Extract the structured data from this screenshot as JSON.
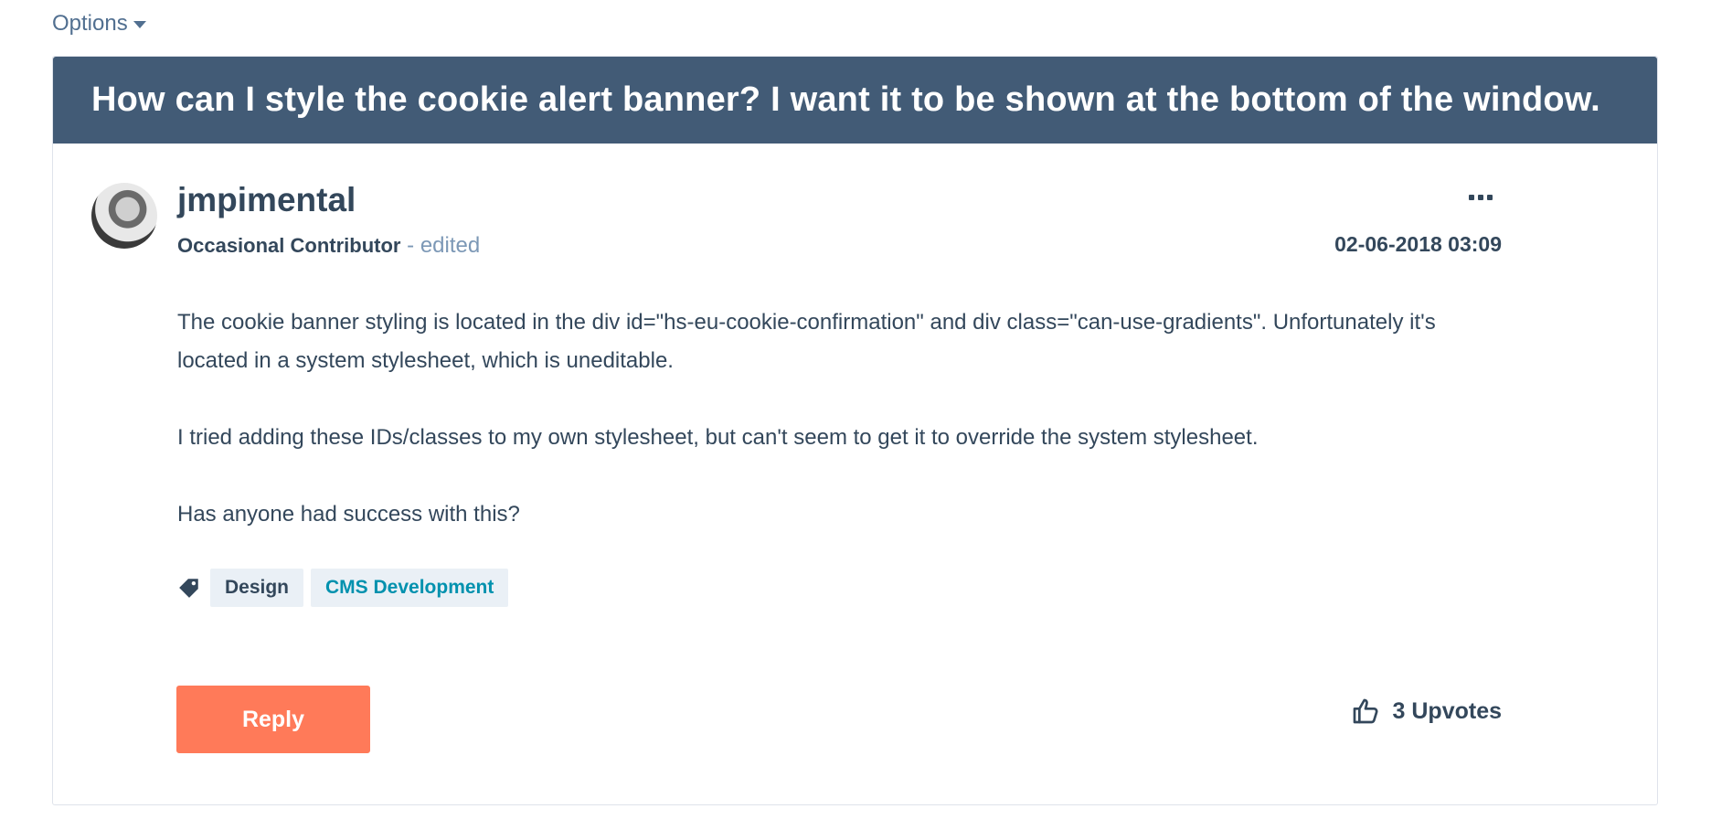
{
  "options": {
    "label": "Options"
  },
  "post": {
    "title": "How can I style the cookie alert banner? I want it to be shown at the bottom of the window.",
    "author": "jmpimental",
    "rank": "Occasional Contributor",
    "edited": " - edited",
    "date": "02-06-2018 03:09",
    "paragraphs": [
      "The cookie banner styling is located in the div id=\"hs-eu-cookie-confirmation\" and div class=\"can-use-gradients\". Unfortunately it's located in a system stylesheet, which is uneditable.",
      "I tried adding these IDs/classes to my own stylesheet, but can't seem to get it to override the system stylesheet.",
      "Has anyone had success with this?"
    ],
    "tags": [
      "Design",
      "CMS Development"
    ],
    "reply_label": "Reply",
    "upvotes_label": "3 Upvotes"
  },
  "colors": {
    "header_bg": "#425b76",
    "reply_bg": "#ff7a59",
    "tag_bg": "#eaf0f6",
    "link": "#0091ae",
    "text": "#33475b"
  },
  "icons": [
    "chevron-down-icon",
    "more-options-icon",
    "tag-icon",
    "thumbs-up-icon"
  ]
}
